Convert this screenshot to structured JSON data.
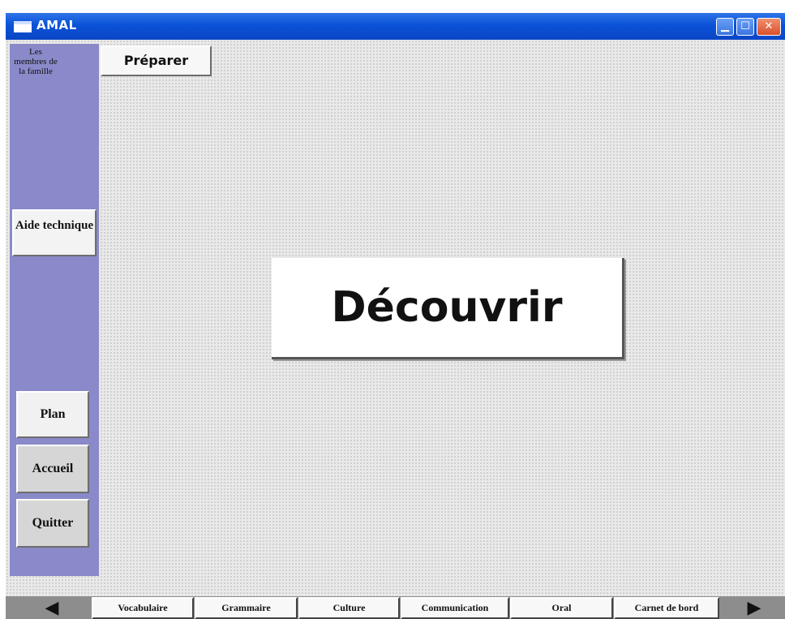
{
  "window": {
    "title": "AMAL",
    "controls": {
      "minimize": "▁",
      "maximize": "☐",
      "close": "✕"
    }
  },
  "sidebar": {
    "lesson_title": "Les membres de la famille",
    "aide_label": "Aide technique",
    "plan_label": "Plan",
    "accueil_label": "Accueil",
    "quitter_label": "Quitter"
  },
  "main": {
    "preparer_label": "Préparer",
    "decouvrir_label": "Découvrir"
  },
  "bottom_nav": {
    "prev_arrow": "◀",
    "next_arrow": "▶",
    "tabs": [
      "Vocabulaire",
      "Grammaire",
      "Culture",
      "Communication",
      "Oral",
      "Carnet de bord"
    ]
  },
  "colors": {
    "titlebar": "#0a52d8",
    "sidebar": "#8a89c9",
    "workspace": "#e9e9e9"
  }
}
